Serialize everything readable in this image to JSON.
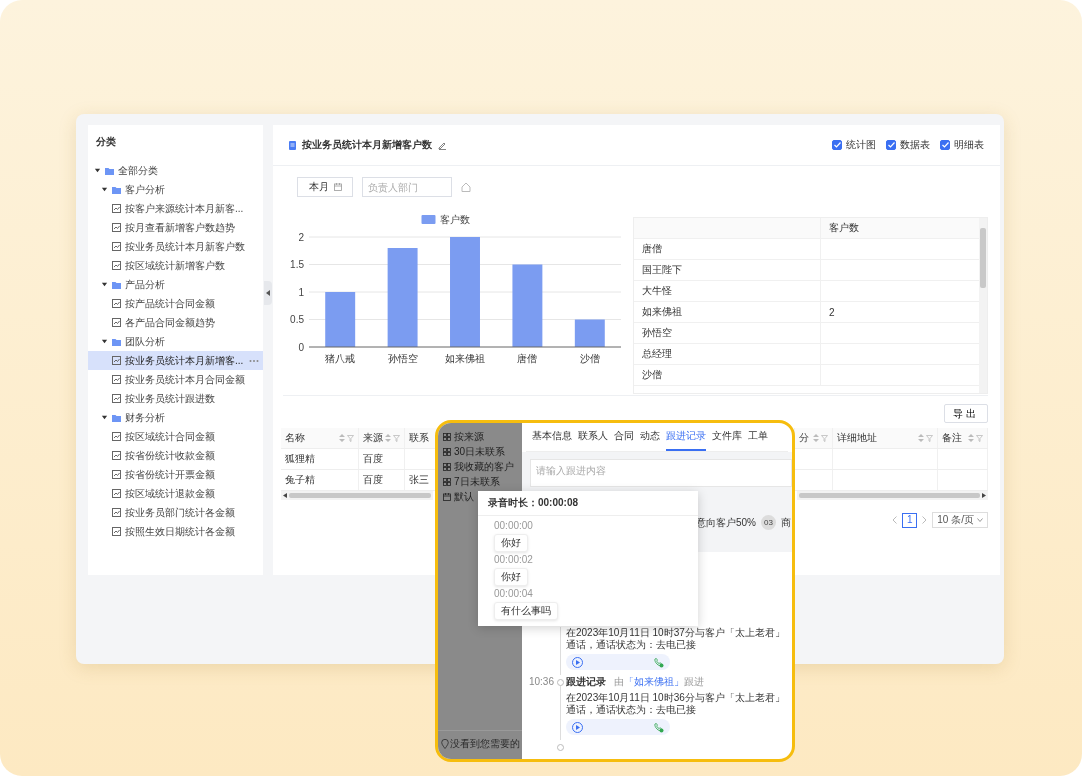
{
  "sidebar": {
    "title": "分类",
    "tree": [
      {
        "kind": "folder",
        "label": "全部分类",
        "expanded": true,
        "children": [
          {
            "kind": "folder",
            "label": "客户分析",
            "expanded": true,
            "children": [
              {
                "kind": "report",
                "label": "按客户来源统计本月新客...",
                "selected": false
              },
              {
                "kind": "report",
                "label": "按月查看新增客户数趋势",
                "selected": false
              },
              {
                "kind": "report",
                "label": "按业务员统计本月新客户数",
                "selected": false
              },
              {
                "kind": "report",
                "label": "按区域统计新增客户数",
                "selected": false
              }
            ]
          },
          {
            "kind": "folder",
            "label": "产品分析",
            "expanded": true,
            "children": [
              {
                "kind": "report",
                "label": "按产品统计合同金额",
                "selected": false
              },
              {
                "kind": "report",
                "label": "各产品合同金额趋势",
                "selected": false
              }
            ]
          },
          {
            "kind": "folder",
            "label": "团队分析",
            "expanded": true,
            "children": [
              {
                "kind": "report",
                "label": "按业务员统计本月新增客...",
                "selected": true
              },
              {
                "kind": "report",
                "label": "按业务员统计本月合同金额",
                "selected": false
              },
              {
                "kind": "report",
                "label": "按业务员统计跟进数",
                "selected": false
              }
            ]
          },
          {
            "kind": "folder",
            "label": "财务分析",
            "expanded": true,
            "children": [
              {
                "kind": "report",
                "label": "按区域统计合同金额",
                "selected": false
              },
              {
                "kind": "report",
                "label": "按省份统计收款金额",
                "selected": false
              },
              {
                "kind": "report",
                "label": "按省份统计开票金额",
                "selected": false
              },
              {
                "kind": "report",
                "label": "按区域统计退款金额",
                "selected": false
              },
              {
                "kind": "report",
                "label": "按业务员部门统计各金额",
                "selected": false
              },
              {
                "kind": "report",
                "label": "按照生效日期统计各金额",
                "selected": false
              }
            ]
          }
        ]
      }
    ]
  },
  "report": {
    "title": "按业务员统计本月新增客户数",
    "toggles": [
      {
        "label": "统计图",
        "checked": true
      },
      {
        "label": "数据表",
        "checked": true
      },
      {
        "label": "明细表",
        "checked": true
      }
    ],
    "filters": {
      "period": "本月",
      "department_placeholder": "负责人部门"
    },
    "chart_data": {
      "type": "bar",
      "categories": [
        "猪八戒",
        "孙悟空",
        "如来佛祖",
        "唐僧",
        "沙僧"
      ],
      "series": [
        {
          "name": "客户数",
          "color": "#7b9cf1",
          "values": [
            1,
            1.8,
            2,
            1.5,
            0.5
          ]
        }
      ],
      "ylim": [
        0,
        2
      ],
      "yticks": [
        0,
        0.5,
        1,
        1.5,
        2
      ],
      "grid": true
    },
    "summary_table": {
      "columns": [
        "客户数"
      ],
      "rows": [
        {
          "name": "唐僧"
        },
        {
          "name": "国王陛下"
        },
        {
          "name": "大牛怪"
        },
        {
          "name": "如来佛祖",
          "count": "2"
        },
        {
          "name": "孙悟空"
        },
        {
          "name": "总经理"
        },
        {
          "name": "沙僧"
        }
      ]
    }
  },
  "detail": {
    "export_button": "导出",
    "columns": [
      "名称",
      "来源",
      "联系",
      "分",
      "详细地址",
      "备注"
    ],
    "rows": [
      {
        "cells": [
          "狐狸精",
          "百度"
        ]
      },
      {
        "cells": [
          "兔子精",
          "百度",
          "张三"
        ]
      }
    ],
    "pagination": {
      "pages": [
        {
          "label": "1",
          "selected": true
        }
      ],
      "page_size": "10 条/页"
    }
  },
  "detail_card": {
    "views": [
      {
        "kind": "grid",
        "label": "按来源"
      },
      {
        "kind": "grid",
        "label": "30日未联系"
      },
      {
        "kind": "grid",
        "label": "我收藏的客户"
      },
      {
        "kind": "grid",
        "label": "7日未联系"
      },
      {
        "kind": "calendar",
        "label": "默认"
      }
    ],
    "hint": "没看到您需要的",
    "tabs": [
      {
        "label": "基本信息",
        "selected": false
      },
      {
        "label": "联系人",
        "selected": false
      },
      {
        "label": "合同",
        "selected": false
      },
      {
        "label": "动态",
        "selected": false
      },
      {
        "label": "跟进记录",
        "selected": true
      },
      {
        "label": "文件库",
        "selected": false
      },
      {
        "label": "工单",
        "selected": false
      }
    ],
    "note_placeholder": "请输入跟进内容",
    "stages": [
      {
        "kind": "label",
        "label": "意向客户50%"
      },
      {
        "kind": "numbered",
        "number": "03",
        "label": "商"
      }
    ],
    "timeline": [
      {
        "text": "在2023年10月11日 10时37分与客户「太上老君」通话，通话状态为：去电已接"
      },
      {
        "time": "10:36",
        "title": "跟进记录",
        "by_before": "由",
        "by_name": "「如来佛祖」",
        "by_after": "跟进",
        "text": "在2023年10月11日 10时36分与客户「太上老君」通话，通话状态为：去电已接"
      }
    ],
    "recording": {
      "title": "录音时长：00:00:08",
      "messages": [
        {
          "time": "00:00:00",
          "text": "你好"
        },
        {
          "time": "00:00:02",
          "text": "你好"
        },
        {
          "time": "00:00:04",
          "text": "有什么事吗"
        }
      ]
    }
  }
}
